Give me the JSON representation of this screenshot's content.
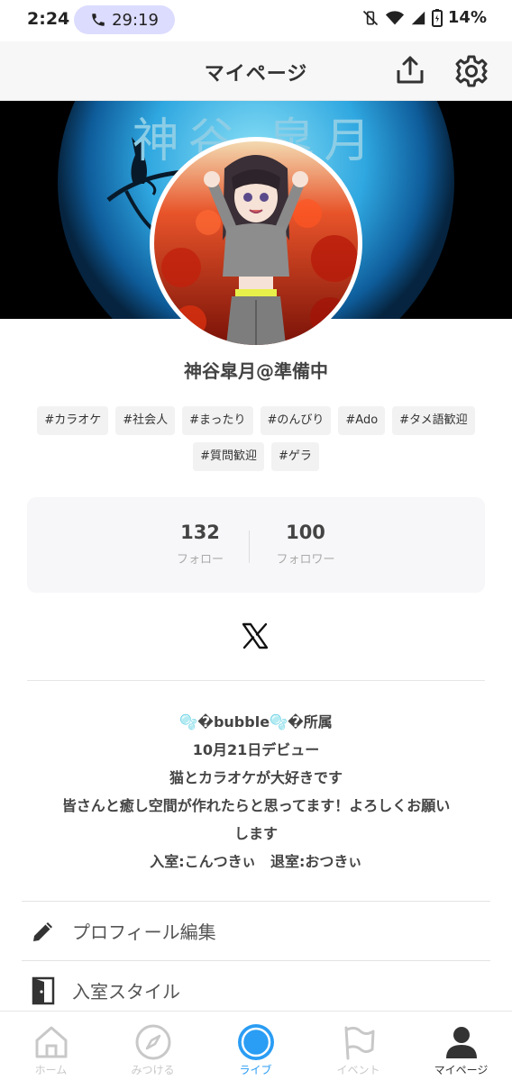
{
  "status_bar": {
    "time": "2:24",
    "call_duration": "29:19",
    "battery": "14%"
  },
  "header": {
    "title": "マイページ"
  },
  "banner": {
    "text": "神谷 皐月"
  },
  "profile": {
    "name": "神谷皐月@準備中",
    "tags": [
      "#カラオケ",
      "#社会人",
      "#まったり",
      "#のんびり",
      "#Ado",
      "#タメ語歓迎",
      "#質問歓迎",
      "#ゲラ"
    ]
  },
  "stats": {
    "follow": {
      "count": "132",
      "label": "フォロー"
    },
    "followers": {
      "count": "100",
      "label": "フォロワー"
    }
  },
  "bio": {
    "lines": [
      "🫧�bubble🫧�所属",
      "10月21日デビュー",
      "猫とカラオケが大好きです",
      "皆さんと癒し空間が作れたらと思ってます！よろしくお願い",
      "します",
      "入室:こんつきぃ　退室:おつきぃ"
    ]
  },
  "menu": {
    "edit_profile": "プロフィール編集",
    "entry_style": "入室スタイル"
  },
  "nav": {
    "home": "ホーム",
    "discover": "みつける",
    "live": "ライブ",
    "event": "イベント",
    "mypage": "マイページ"
  },
  "colors": {
    "accent_blue": "#2a9df4",
    "tag_bg": "#f2f2f2",
    "call_pill": "#dcdcff"
  }
}
